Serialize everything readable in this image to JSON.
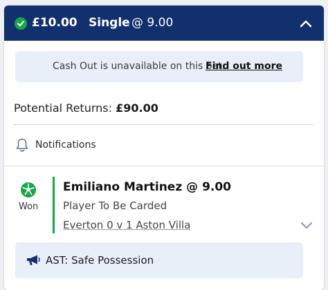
{
  "bet_header": {
    "stake": "£10.00",
    "bet_type": "Single",
    "odds": "@ 9.00",
    "status_icon": "check-circle-icon",
    "collapse_icon": "chevron-up-icon"
  },
  "cash_out": {
    "message": "Cash Out is unavailable on this bet.",
    "link_label": "Find out more"
  },
  "returns": {
    "label": "Potential Returns:",
    "value": "£90.00"
  },
  "notifications": {
    "icon": "bell-icon",
    "label": "Notifications"
  },
  "selection": {
    "status_icon": "football-icon",
    "status_label": "Won",
    "name": "Emiliano Martinez @ 9.00",
    "market": "Player To Be Carded",
    "event": "Everton 0 v 1 Aston Villa",
    "expand_icon": "chevron-down-icon"
  },
  "commentary": {
    "icon": "megaphone-icon",
    "text": "AST: Safe Possession"
  },
  "colors": {
    "header_bg": "#11306d",
    "won_green": "#1aa54a",
    "info_bg": "#e9eff9"
  }
}
